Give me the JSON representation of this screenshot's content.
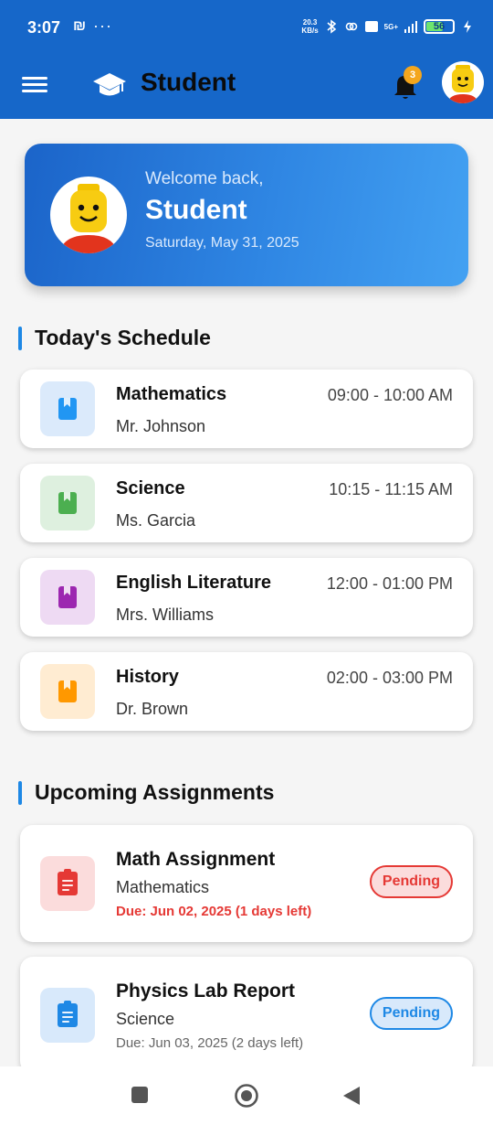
{
  "status": {
    "time": "3:07",
    "extra": "₪",
    "net_speed_top": "20.3",
    "net_speed_bottom": "KB/s",
    "net_label": "5G+",
    "battery": "56"
  },
  "app_bar": {
    "title": "Student",
    "notification_count": "3"
  },
  "welcome": {
    "greeting": "Welcome back,",
    "name": "Student",
    "date": "Saturday, May 31, 2025"
  },
  "schedule": {
    "title": "Today's Schedule",
    "items": [
      {
        "subject": "Mathematics",
        "teacher": "Mr. Johnson",
        "time": "09:00 - 10:00 AM",
        "color": "#2196f3",
        "tint": "#dbeafb"
      },
      {
        "subject": "Science",
        "teacher": "Ms. Garcia",
        "time": "10:15 - 11:15 AM",
        "color": "#4caf50",
        "tint": "#def0df"
      },
      {
        "subject": "English Literature",
        "teacher": "Mrs. Williams",
        "time": "12:00 - 01:00 PM",
        "color": "#9c27b0",
        "tint": "#eedaf3"
      },
      {
        "subject": "History",
        "teacher": "Dr. Brown",
        "time": "02:00 - 03:00 PM",
        "color": "#ff9800",
        "tint": "#ffecd2"
      }
    ]
  },
  "assignments": {
    "title": "Upcoming Assignments",
    "items": [
      {
        "title": "Math Assignment",
        "subject": "Mathematics",
        "due": "Due: Jun 02, 2025 (1 days left)",
        "status": "Pending",
        "color": "#e53935",
        "tint": "#fbdcdc",
        "due_color": "#e53935"
      },
      {
        "title": "Physics Lab Report",
        "subject": "Science",
        "due": "Due: Jun 03, 2025 (2 days left)",
        "status": "Pending",
        "color": "#1e88e5",
        "tint": "#d8e9fb",
        "due_color": "#666666"
      }
    ]
  },
  "icons": {
    "menu": "menu-icon",
    "logo": "graduation-cap-icon",
    "bell": "bell-icon",
    "subject": "book-icon",
    "assignment": "clipboard-icon"
  },
  "colors": {
    "primary": "#1667c9",
    "accent": "#1e88e5",
    "badge": "#f4a61d"
  }
}
